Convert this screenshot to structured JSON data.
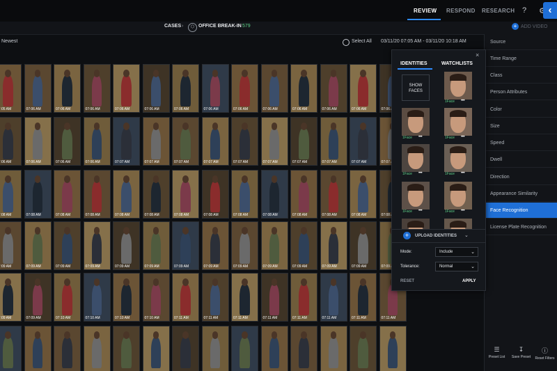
{
  "topnav": {
    "review": "REVIEW",
    "respond": "RESPOND",
    "research": "RESEARCH",
    "help_icon": "help-icon",
    "settings_icon": "gear-icon"
  },
  "breadcrumb": {
    "cases": "CASES",
    "separator": "›",
    "case_name": "OFFICE BREAK-IN",
    "count": "579"
  },
  "add_video": "ADD VIDEO",
  "toolbar": {
    "sort": "Newest",
    "select_all": "Select All",
    "time_range": "03/11/20 07:05 AM - 03/11/20 10:18 AM"
  },
  "colors": {
    "accent": "#1f6fd6",
    "count_green": "#5fd38a",
    "background": "#0d0f12",
    "panel": "#121418"
  },
  "grid_rows": [
    {
      "timestamps": [
        "07:05 AM",
        "07:06 AM",
        "07:06 AM",
        "07:06 AM",
        "07:06 AM",
        "07:06 AM",
        "07:06 AM",
        "07:06 AM",
        "07:06 AM",
        "07:06 AM",
        "07:06 AM",
        "07:06 AM",
        "07:06 AM",
        "07:06 AM"
      ]
    },
    {
      "timestamps": [
        "07:06 AM",
        "07:06 AM",
        "07:06 AM",
        "07:06 AM",
        "07:07 AM",
        "07:07 AM",
        "07:07 AM",
        "07:07 AM",
        "07:07 AM",
        "07:07 AM",
        "07:07 AM",
        "07:07 AM",
        "07:07 AM",
        "07:07 AM"
      ]
    },
    {
      "timestamps": [
        "07:08 AM",
        "07:08 AM",
        "07:08 AM",
        "07:08 AM",
        "07:08 AM",
        "07:08 AM",
        "07:08 AM",
        "07:08 AM",
        "07:08 AM",
        "07:08 AM",
        "07:08 AM",
        "07:08 AM",
        "07:08 AM",
        "07:08 AM"
      ]
    },
    {
      "timestamps": [
        "07:09 AM",
        "07:09 AM",
        "07:09 AM",
        "07:09 AM",
        "07:09 AM",
        "07:09 AM",
        "07:09 AM",
        "07:09 AM",
        "07:09 AM",
        "07:09 AM",
        "07:09 AM",
        "07:09 AM",
        "07:09 AM",
        "07:09 AM"
      ]
    },
    {
      "timestamps": [
        "07:09 AM",
        "07:09 AM",
        "07:10 AM",
        "07:10 AM",
        "07:10 AM",
        "07:10 AM",
        "07:11 AM",
        "07:11 AM",
        "07:11 AM",
        "07:11 AM",
        "07:11 AM",
        "07:11 AM",
        "07:11 AM",
        "07:11 AM"
      ]
    },
    {
      "timestamps": [
        "",
        "",
        "",
        "",
        "",
        "",
        "",
        "",
        "",
        "",
        "",
        "",
        "",
        ""
      ]
    }
  ],
  "sidebar": {
    "items": [
      "Source",
      "Time Range",
      "Class",
      "Person Attributes",
      "Color",
      "Size",
      "Speed",
      "Dwell",
      "Direction",
      "Appearance Similarity",
      "Face Recognition",
      "License Plate Recognition"
    ],
    "active": "Face Recognition",
    "footer": [
      {
        "label": "Preset List",
        "icon": "list-icon"
      },
      {
        "label": "Save Preset",
        "icon": "save-icon"
      },
      {
        "label": "Reset Filters",
        "icon": "reset-icon"
      }
    ]
  },
  "face_panel": {
    "tabs": [
      "IDENTITIES",
      "WATCHLISTS"
    ],
    "close": "×",
    "show_faces": "SHOW FACES",
    "face_cards": [
      {
        "label": "1Face",
        "dots": "• • •"
      },
      {
        "label": "1Face",
        "dots": "• • •"
      },
      {
        "label": "1Face",
        "dots": "• • •"
      },
      {
        "label": "1Face",
        "dots": "• • •"
      },
      {
        "label": "1Face",
        "dots": "• • •"
      },
      {
        "label": "1Face",
        "dots": "• • •"
      },
      {
        "label": "1Face",
        "dots": "• • •"
      },
      {
        "label": "1Face",
        "dots": "• • •"
      },
      {
        "label": "1Face",
        "dots": "• • •"
      }
    ],
    "upload_label": "UPLOAD IDENTITIES",
    "mode_label": "Mode:",
    "mode_value": "Include",
    "tolerance_label": "Tolerance:",
    "tolerance_value": "Normal",
    "reset": "RESET",
    "apply": "APPLY"
  }
}
